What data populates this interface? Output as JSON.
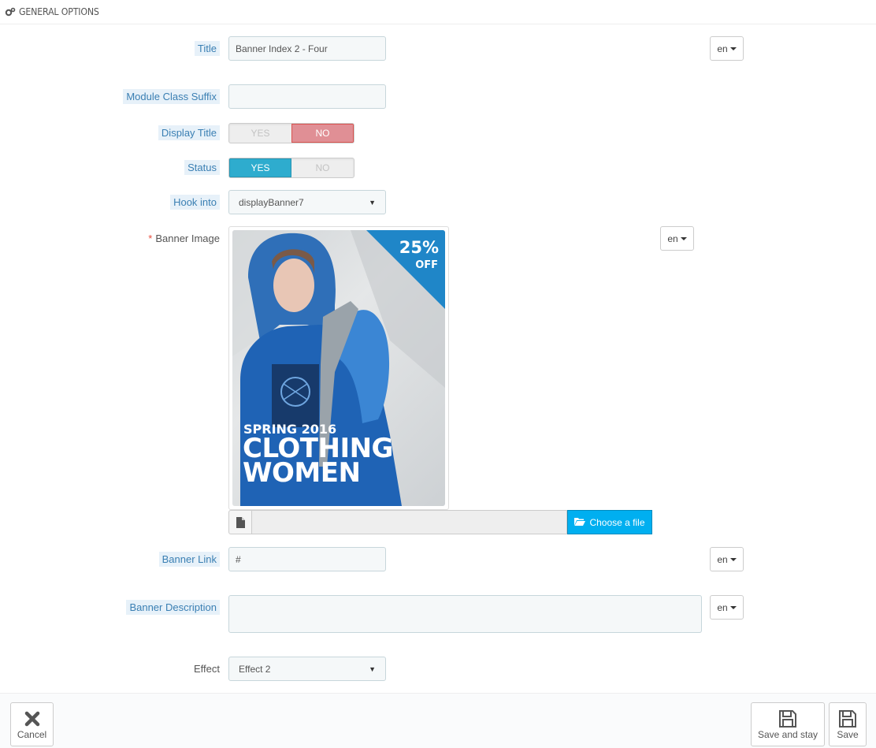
{
  "header": {
    "title": "GENERAL OPTIONS",
    "icon": "cogs-icon"
  },
  "fields": {
    "title": {
      "label": "Title",
      "value": "Banner Index 2 - Four",
      "lang": "en"
    },
    "module_class_suffix": {
      "label": "Module Class Suffix",
      "value": ""
    },
    "display_title": {
      "label": "Display Title",
      "yes": "YES",
      "no": "NO",
      "selected": "NO"
    },
    "status": {
      "label": "Status",
      "yes": "YES",
      "no": "NO",
      "selected": "YES"
    },
    "hook_into": {
      "label": "Hook into",
      "value": "displayBanner7"
    },
    "banner_image": {
      "required_mark": "*",
      "label": "Banner Image",
      "lang": "en",
      "image_texts": {
        "discount": "25%",
        "off": "OFF",
        "season": "SPRING 2016",
        "line1": "CLOTHING",
        "line2": "WOMEN"
      },
      "choose_label": "Choose a file",
      "file_name": ""
    },
    "banner_link": {
      "label": "Banner Link",
      "value": "#",
      "lang": "en"
    },
    "banner_description": {
      "label": "Banner Description",
      "value": "",
      "lang": "en"
    },
    "effect": {
      "label": "Effect",
      "value": "Effect 2"
    }
  },
  "footer": {
    "cancel_label": "Cancel",
    "save_stay_label": "Save and stay",
    "save_label": "Save"
  },
  "colors": {
    "accent_blue": "#00aff0",
    "yes_on": "#2eacce",
    "no_on": "#e08f95",
    "hint_bg": "#e7f1f9",
    "hint_text": "#3a7fb3"
  }
}
